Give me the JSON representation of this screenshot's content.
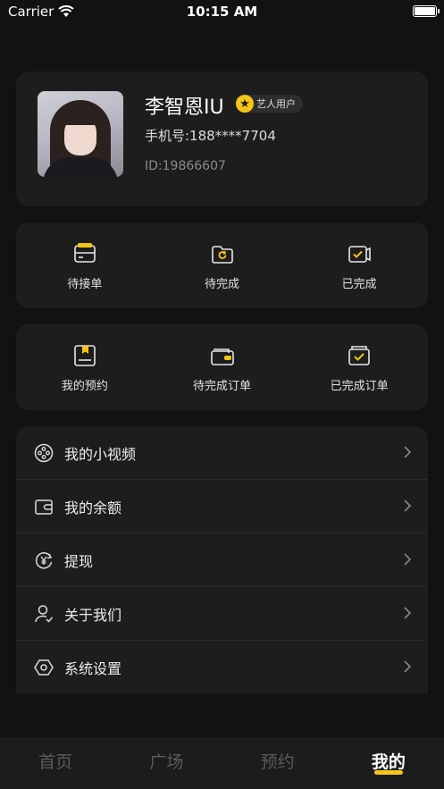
{
  "status": {
    "carrier": "Carrier",
    "time": "10:15 AM"
  },
  "profile": {
    "name": "李智恩IU",
    "badge": "艺人用户",
    "phone": "手机号:188****7704",
    "id": "ID:19866607"
  },
  "orders": [
    {
      "label": "待接单",
      "icon": "pending-order-icon"
    },
    {
      "label": "待完成",
      "icon": "in-progress-icon"
    },
    {
      "label": "已完成",
      "icon": "completed-icon"
    }
  ],
  "bookings": [
    {
      "label": "我的预约",
      "icon": "my-booking-icon"
    },
    {
      "label": "待完成订单",
      "icon": "wallet-order-icon"
    },
    {
      "label": "已完成订单",
      "icon": "completed-order-icon"
    }
  ],
  "menu": [
    {
      "label": "我的小视频",
      "icon": "video-reel-icon"
    },
    {
      "label": "我的余额",
      "icon": "wallet-icon"
    },
    {
      "label": "提现",
      "icon": "withdraw-yen-icon"
    },
    {
      "label": "关于我们",
      "icon": "user-check-icon"
    },
    {
      "label": "系统设置",
      "icon": "settings-hexagon-icon"
    }
  ],
  "tabs": [
    {
      "label": "首页"
    },
    {
      "label": "广场"
    },
    {
      "label": "预约"
    },
    {
      "label": "我的"
    }
  ],
  "colors": {
    "accent": "#f5c518",
    "background": "#121212",
    "card": "#1d1d1d"
  }
}
